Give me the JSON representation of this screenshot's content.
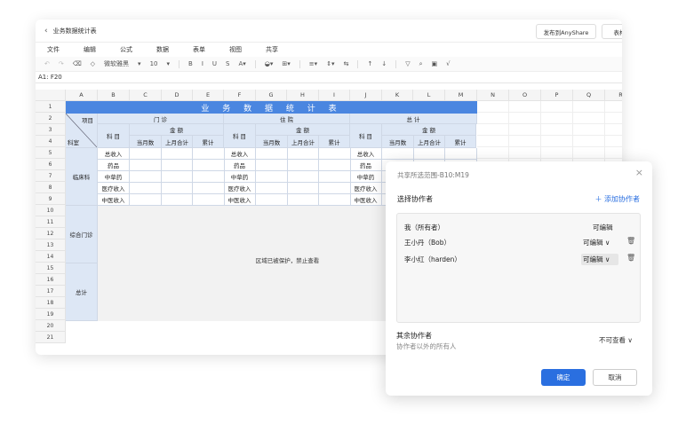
{
  "window": {
    "title": "业务数据统计表",
    "back_icon": "chevron-left-icon",
    "publish_btn": "发布到AnyShare",
    "table_btn": "表格"
  },
  "menu": [
    "文件",
    "编辑",
    "公式",
    "数据",
    "表单",
    "视图",
    "共享"
  ],
  "toolbar": {
    "font": "微软雅黑",
    "size": "10",
    "bold": "B",
    "italic": "I",
    "underline": "U",
    "strike": "S"
  },
  "formula": {
    "cell_ref": "A1: F20"
  },
  "columns": [
    "A",
    "B",
    "C",
    "D",
    "E",
    "F",
    "G",
    "H",
    "I",
    "J",
    "K",
    "L",
    "M",
    "N",
    "O",
    "P",
    "Q",
    "R"
  ],
  "rows": [
    "1",
    "2",
    "3",
    "4",
    "5",
    "6",
    "7",
    "8",
    "9",
    "10",
    "11",
    "12",
    "13",
    "14",
    "15",
    "16",
    "17",
    "18",
    "19",
    "20",
    "21"
  ],
  "sheet": {
    "title": "业 务 数 据 统 计 表",
    "item": "项目",
    "dept": "科室",
    "subject": "科 目",
    "outpatient": "门 诊",
    "inpatient": "住 院",
    "total": "总 计",
    "amount": "金 额",
    "cur": "当月数",
    "prev": "上月合计",
    "cum": "累计",
    "rowlabels": [
      "总收入",
      "药品",
      "中草药",
      "医疗收入",
      "中医收入"
    ],
    "clinical": "临床科",
    "general": "综合门诊",
    "sum": "总计",
    "protected": "区域已被保护，禁止查看"
  },
  "dialog": {
    "title": "共享所选范围-B10:M19",
    "choose": "选择协作者",
    "add": "＋ 添加协作者",
    "owner": "我（所有者）",
    "owner_perm": "可编辑",
    "collabs": [
      {
        "name": "王小丹（Bob）",
        "perm": "可编辑 ∨"
      },
      {
        "name": "李小红（harden）",
        "perm": "可编辑 ∨"
      }
    ],
    "others": "其余协作者",
    "others_sub": "协作者以外的所有人",
    "others_perm": "不可查看 ∨",
    "ok": "确定",
    "cancel": "取消"
  }
}
